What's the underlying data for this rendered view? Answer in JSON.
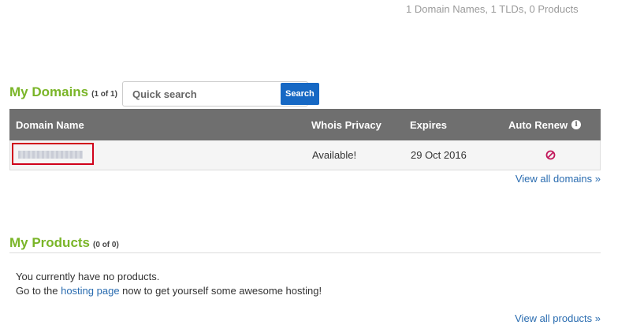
{
  "summary": "1 Domain Names, 1 TLDs, 0 Products",
  "domains": {
    "title": "My Domains",
    "count": "(1 of 1)",
    "search": {
      "placeholder": "Quick search",
      "button": "Search"
    },
    "headers": {
      "name": "Domain Name",
      "privacy": "Whois Privacy",
      "expires": "Expires",
      "renew": "Auto Renew"
    },
    "rows": [
      {
        "name": "",
        "privacy": "Available!",
        "expires": "29 Oct 2016",
        "auto_renew": "off"
      }
    ],
    "view_all": "View all domains »"
  },
  "products": {
    "title": "My Products",
    "count": "(0 of 0)",
    "empty_line1": "You currently have no products.",
    "line2_prefix": "Go to the ",
    "line2_link": "hosting page",
    "line2_suffix": " now to get yourself some awesome hosting!",
    "view_all": "View all products »"
  },
  "colors": {
    "accent_green": "#7ab528",
    "search_blue": "#1668c4",
    "link_blue": "#2a6cb0",
    "header_grey": "#6f6f6f",
    "disabled_red": "#c2185b",
    "highlight_red": "#d0021b"
  },
  "icons": {
    "info": "info-circle-icon",
    "renew_off": "ban-icon"
  }
}
